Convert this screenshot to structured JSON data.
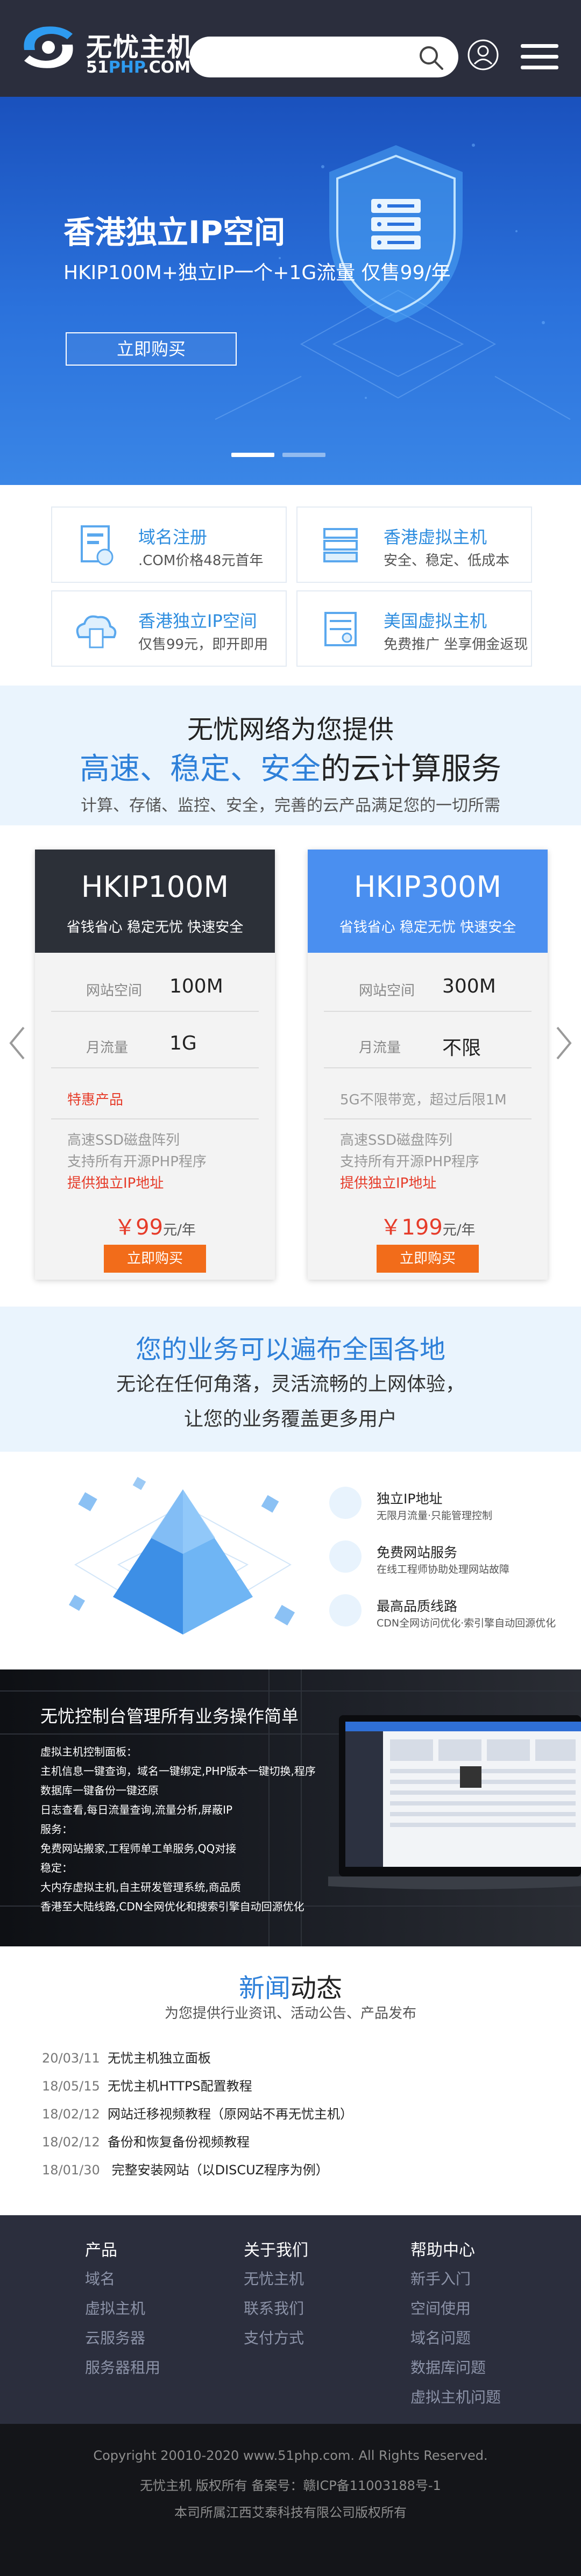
{
  "header": {
    "logo_cn": "无忧主机",
    "logo_en_pre": "51",
    "logo_en_mid": "PHP",
    "logo_en_post": ".COM",
    "search_placeholder": ""
  },
  "hero": {
    "title": "香港独立IP空间",
    "subtitle": "HKIP100M+独立IP一个+1G流量 仅售99/年",
    "button": "立即购买"
  },
  "services": [
    {
      "title": "域名注册",
      "desc": ".COM价格48元首年",
      "icon": "domain-icon"
    },
    {
      "title": "香港虚拟主机",
      "desc": "安全、稳定、低成本",
      "icon": "hk-host-icon"
    },
    {
      "title": "香港独立IP空间",
      "desc": "仅售99元，即开即用",
      "icon": "ip-space-icon"
    },
    {
      "title": "美国虚拟主机",
      "desc": "免费推广 坐享佣金返现",
      "icon": "us-host-icon"
    }
  ],
  "cloud": {
    "line1": "无忧网络为您提供",
    "line2_blue": "高速、稳定、安全",
    "line2_rest": "的云计算服务",
    "line3": "计算、存储、监控、安全，完善的云产品满足您的一切所需"
  },
  "pricing": {
    "cards": [
      {
        "name": "HKIP100M",
        "tagline": "省钱省心 稳定无忧 快速安全",
        "space_label": "网站空间",
        "space_value": "100M",
        "traffic_label": "月流量",
        "traffic_value": "1G",
        "extra": "特惠产品",
        "f1": "高速SSD磁盘阵列",
        "f2": "支持所有开源PHP程序",
        "f3": "提供独立IP地址",
        "price": "￥99",
        "unit": "元/年",
        "button": "立即购买"
      },
      {
        "name": "HKIP300M",
        "tagline": "省钱省心 稳定无忧 快速安全",
        "space_label": "网站空间",
        "space_value": "300M",
        "traffic_label": "月流量",
        "traffic_value": "不限",
        "extra": "5G不限带宽，超过后限1M",
        "f1": "高速SSD磁盘阵列",
        "f2": "支持所有开源PHP程序",
        "f3": "提供独立IP地址",
        "price": "￥199",
        "unit": "元/年",
        "button": "立即购买"
      }
    ]
  },
  "national": {
    "title": "您的业务可以遍布全国各地",
    "line1": "无论在任何角落，灵活流畅的上网体验，",
    "line2": "让您的业务覆盖更多用户"
  },
  "features": [
    {
      "title": "独立IP地址",
      "desc": "无限月流量·只能管理控制"
    },
    {
      "title": "免费网站服务",
      "desc": "在线工程师协助处理网站故障"
    },
    {
      "title": "最高品质线路",
      "desc": "CDN全网访问优化·索引擎自动回源优化"
    }
  ],
  "console": {
    "title": "无忧控制台管理所有业务操作简单",
    "lines": [
      "虚拟主机控制面板：",
      "主机信息一键查询，域名一键绑定,PHP版本一键切换,程序",
      "数据库一键备份一键还原",
      "日志查看,每日流量查询,流量分析,屏蔽IP",
      "服务：",
      "免费网站搬家,工程师单工单服务,QQ对接",
      "稳定：",
      "大内存虚拟主机,自主研发管理系统,商品质",
      "香港至大陆线路,CDN全网优化和搜索引擎自动回源优化"
    ]
  },
  "news": {
    "title_blue": "新闻",
    "title_rest": "动态",
    "subtitle": "为您提供行业资讯、活动公告、产品发布",
    "items": [
      {
        "date": "20/03/11",
        "title": "无忧主机独立面板"
      },
      {
        "date": "18/05/15",
        "title": "无忧主机HTTPS配置教程"
      },
      {
        "date": "18/02/12",
        "title": "网站迁移视频教程（原网站不再无忧主机）"
      },
      {
        "date": "18/02/12",
        "title": "备份和恢复备份视频教程"
      },
      {
        "date": "18/01/30",
        "title": " 完整安装网站（以DISCUZ程序为例）"
      }
    ]
  },
  "footer": {
    "cols": [
      {
        "heading": "产品",
        "links": [
          "域名",
          "虚拟主机",
          "云服务器",
          "服务器租用"
        ]
      },
      {
        "heading": "关于我们",
        "links": [
          "无忧主机",
          "联系我们",
          "支付方式"
        ]
      },
      {
        "heading": "帮助中心",
        "links": [
          "新手入门",
          "空间使用",
          "域名问题",
          "数据库问题",
          "虚拟主机问题"
        ]
      }
    ]
  },
  "copyright": {
    "line1": "Copyright 20010-2020 www.51php.com. All Rights Reserved.",
    "line2": "无忧主机 版权所有  备案号：赣ICP备11003188号-1",
    "line3": "本司所属江西艾泰科技有限公司版权所有"
  },
  "colors": {
    "header_bg": "#2b2e3d",
    "hero_blue": "#2b72dc",
    "accent_blue": "#2e80d9",
    "card1_header": "#2c3038",
    "card2_header": "#4a8ff0",
    "buy_orange": "#f26c1a",
    "price_red": "#e63c2a",
    "footer_bg": "#2b2e3d",
    "copyright_bg": "#141519"
  }
}
